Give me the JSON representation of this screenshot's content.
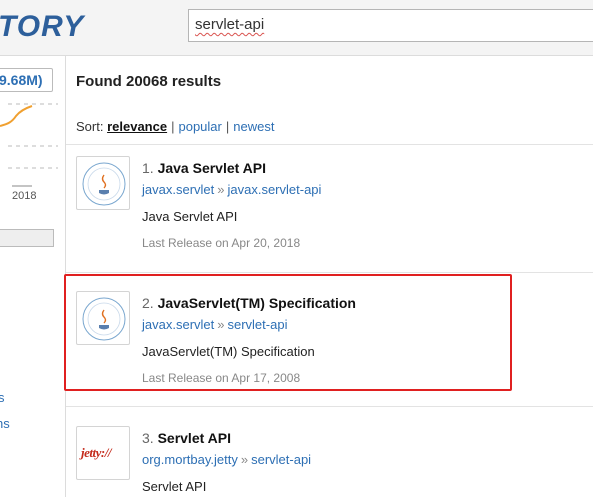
{
  "header": {
    "logo_text": "TORY",
    "search_value": "servlet-api"
  },
  "sidebar": {
    "stat_value": "9.68M)",
    "chart_year": "2018",
    "link_1": "s",
    "link_2": "ns"
  },
  "main": {
    "results_count": "Found 20068 results",
    "sort": {
      "label": "Sort:",
      "relevance": "relevance",
      "popular": "popular",
      "newest": "newest",
      "sep": "|"
    },
    "results": [
      {
        "num": "1.",
        "name": "Java Servlet API",
        "group": "javax.servlet",
        "artifact": "javax.servlet-api",
        "arrow": "»",
        "description": "Java Servlet API",
        "release": "Last Release on Apr 20, 2018"
      },
      {
        "num": "2.",
        "name": "JavaServlet(TM) Specification",
        "group": "javax.servlet",
        "artifact": "servlet-api",
        "arrow": "»",
        "description": "JavaServlet(TM) Specification",
        "release": "Last Release on Apr 17, 2008"
      },
      {
        "num": "3.",
        "name": "Servlet API",
        "group": "org.mortbay.jetty",
        "artifact": "servlet-api",
        "arrow": "»",
        "description": "Servlet API",
        "logo_text": "jetty://"
      }
    ]
  },
  "colors": {
    "link": "#2d6fb4",
    "highlight": "#e02020",
    "spark": "#f0a030"
  }
}
